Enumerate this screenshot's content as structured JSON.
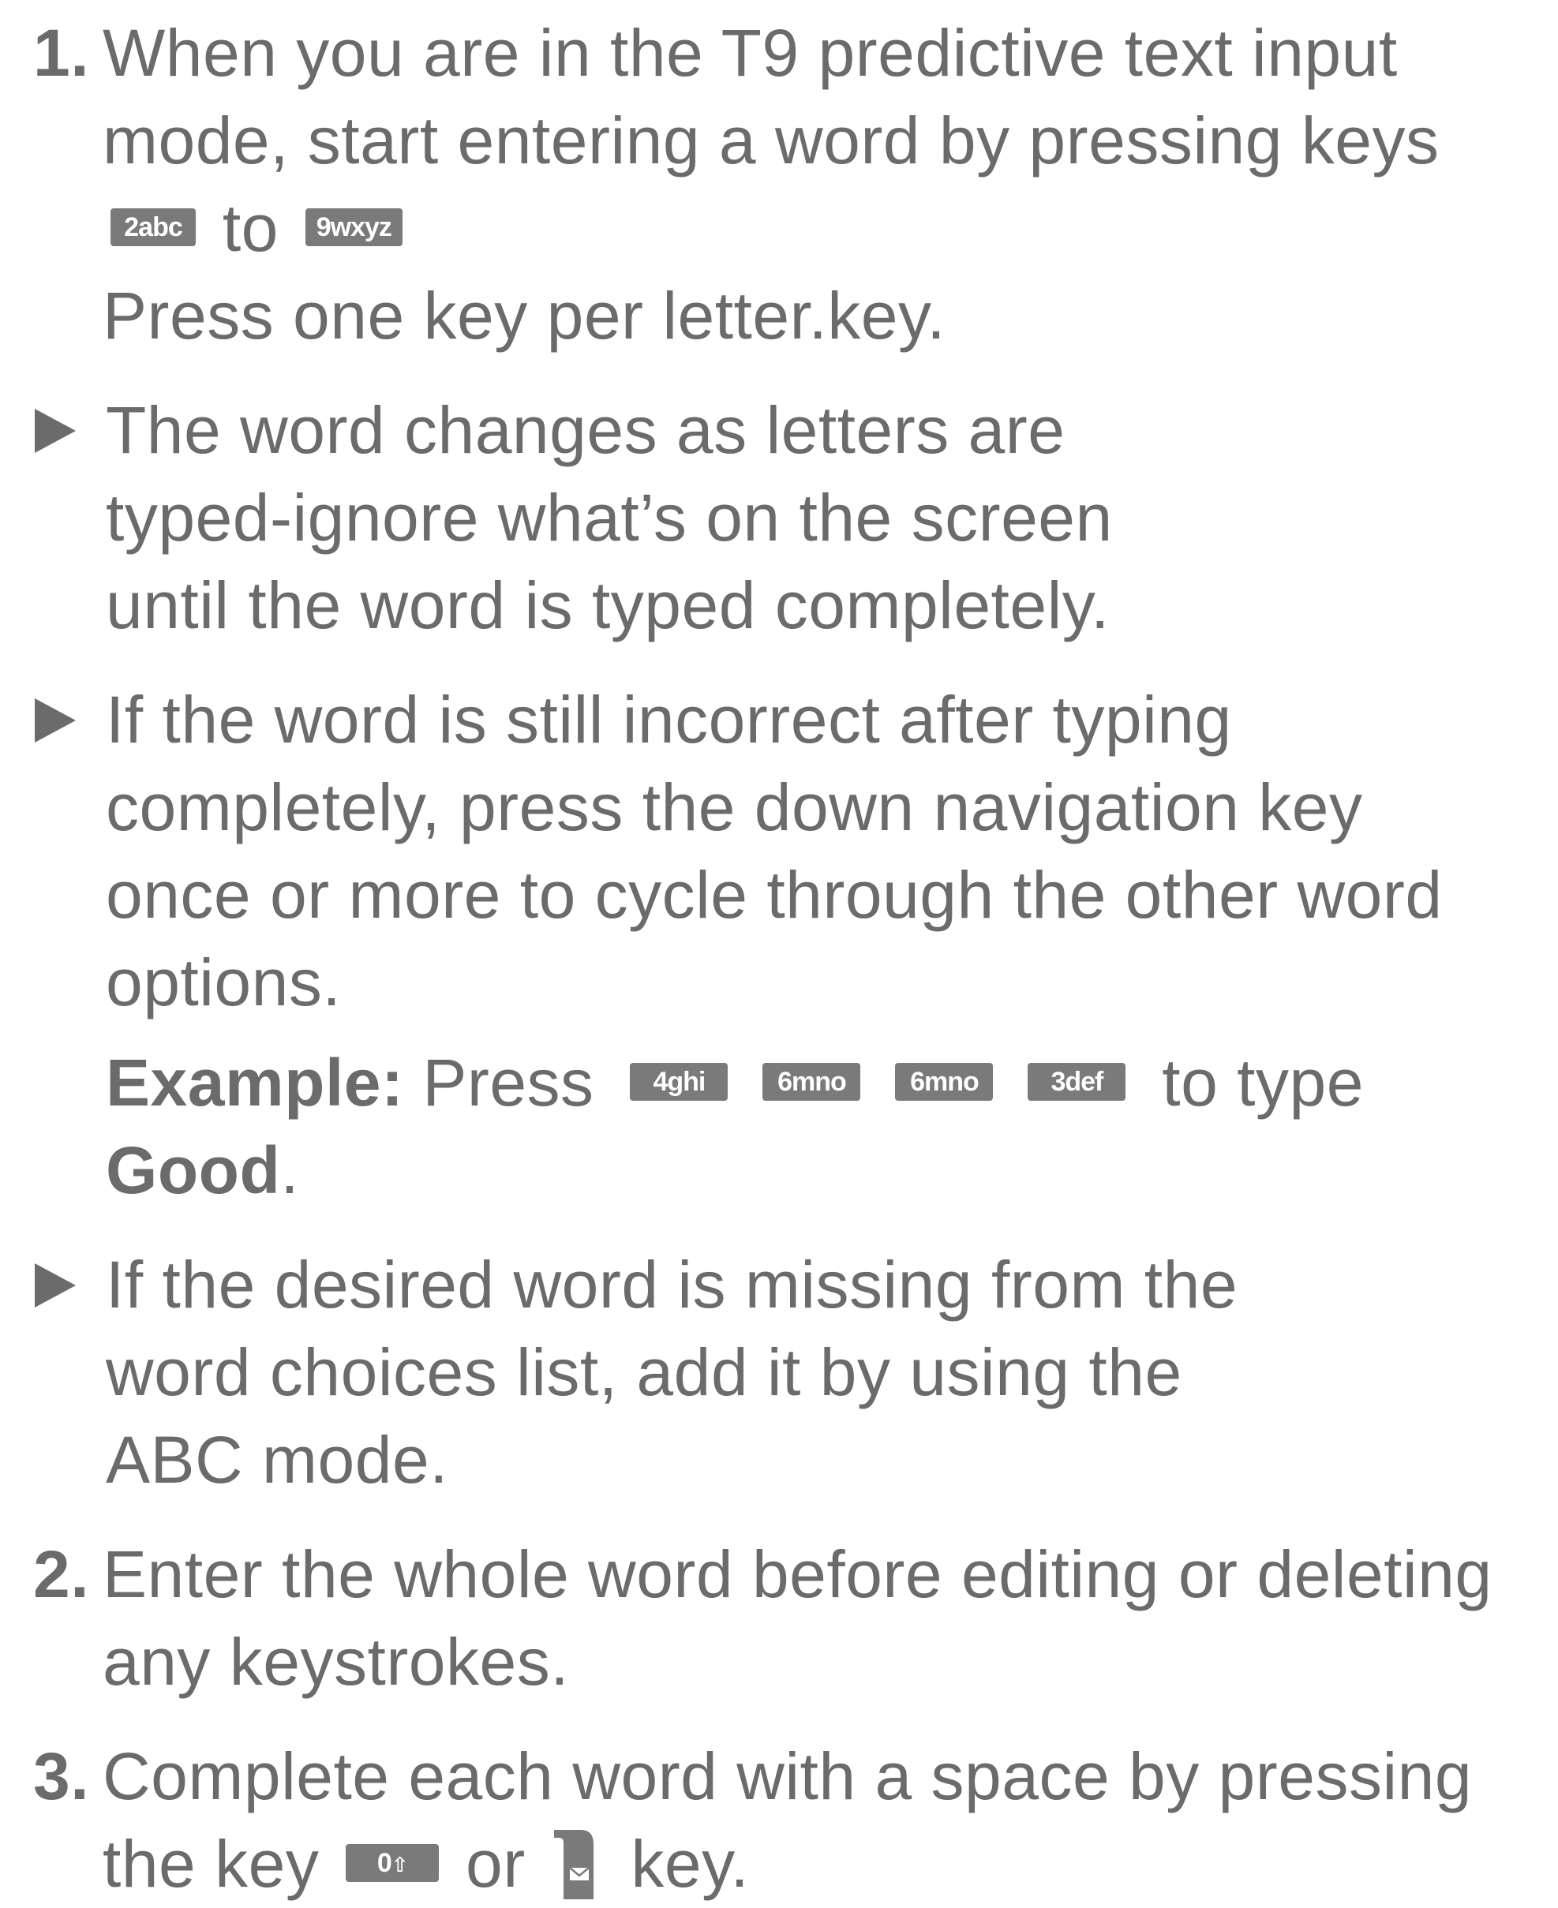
{
  "steps": [
    {
      "number": "1.",
      "text_1": "When you are in the T9 predictive text input mode, start entering a word by pressing keys",
      "key_start": "2abc",
      "text_2": "to",
      "key_end": "9wxyz",
      "text_3": "Press one key per letter.key."
    }
  ],
  "bullets": [
    {
      "text": "The word changes as letters are typed-ignore what’s on the screen until the word is typed completely."
    },
    {
      "text": "If the word is still incorrect after typing completely, press the down navigation key once or more to cycle through the other word options."
    },
    {
      "text": "If the desired word is missing from the word choices list, add it by using the ABC mode."
    }
  ],
  "example": {
    "label": "Example:",
    "press": "Press",
    "keys": [
      "4ghi",
      "6mno",
      "6mno",
      "3def"
    ],
    "to_type": "to type",
    "word": "Good",
    "period": "."
  },
  "step2": {
    "number": "2.",
    "text": "Enter the whole word before editing or deleting any keystrokes."
  },
  "step3": {
    "number": "3.",
    "text_1": "Complete each word with a space by pressing the key",
    "key_space": "0",
    "text_or": "or",
    "text_end": "key."
  },
  "icons": {
    "bullet": "triangle-right-icon",
    "space_key": "space-key-icon",
    "message_soft_key": "message-soft-key-icon"
  },
  "colors": {
    "text": "#6b6b6b",
    "key_bg": "#7a7a7a",
    "key_text": "#ffffff"
  }
}
